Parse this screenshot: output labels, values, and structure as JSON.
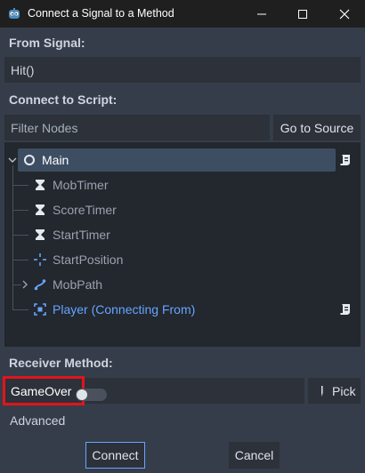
{
  "window": {
    "title": "Connect a Signal to a Method",
    "minimize_icon": "minimize-icon",
    "maximize_icon": "maximize-icon",
    "close_icon": "close-icon"
  },
  "from_signal": {
    "label": "From Signal:",
    "value": "Hit()"
  },
  "connect_to_script": {
    "label": "Connect to Script:",
    "filter_placeholder": "Filter Nodes",
    "go_to_source": "Go to Source"
  },
  "tree": {
    "nodes": [
      {
        "name": "Main",
        "icon": "circle-node-icon",
        "selected": true,
        "has_script": true
      },
      {
        "name": "MobTimer",
        "icon": "timer-icon"
      },
      {
        "name": "ScoreTimer",
        "icon": "timer-icon"
      },
      {
        "name": "StartTimer",
        "icon": "timer-icon"
      },
      {
        "name": "StartPosition",
        "icon": "marker-icon"
      },
      {
        "name": "MobPath",
        "icon": "path-icon"
      },
      {
        "name": "Player (Connecting From)",
        "icon": "area-icon",
        "has_script": true
      }
    ]
  },
  "receiver": {
    "label": "Receiver Method:",
    "value": "GameOver",
    "pick": "Pick"
  },
  "advanced": {
    "label": "Advanced",
    "enabled": false
  },
  "buttons": {
    "connect": "Connect",
    "cancel": "Cancel"
  },
  "colors": {
    "accent_blue": "#66a6ff",
    "dim_text": "#9aa2ae",
    "highlight_red": "#e3141b"
  }
}
